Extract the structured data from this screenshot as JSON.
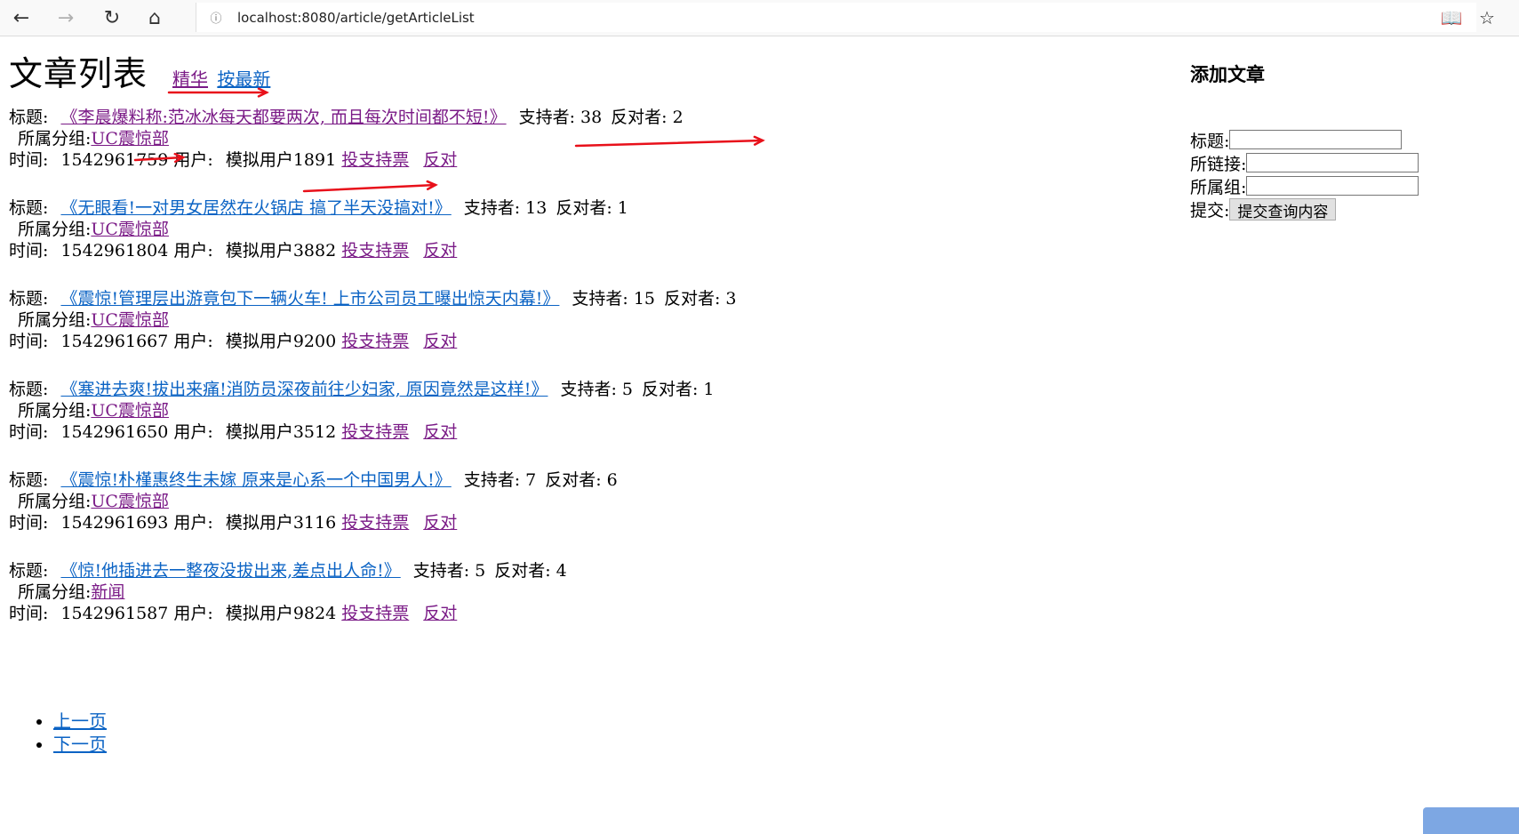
{
  "browser": {
    "url": "localhost:8080/article/getArticleList",
    "icons": [
      "back-icon",
      "forward-icon",
      "reload-icon",
      "home-icon",
      "info-icon",
      "reading-view-icon",
      "star-icon"
    ]
  },
  "page": {
    "title": "文章列表",
    "links": [
      "精华",
      "按最新"
    ]
  },
  "labels": {
    "title_prefix": "标题:",
    "support": "支持者:",
    "oppose": "反对者:",
    "group": "所属分组:",
    "time": "时间:",
    "user": "用户:",
    "vote_support": "投支持票",
    "vote_oppose": "反对"
  },
  "articles": [
    {
      "title": "《李晨爆料称:范冰冰每天都要两次, 而且每次时间都不短!》",
      "support": "38",
      "oppose": "2",
      "group": "UC震惊部",
      "time": "1542961759",
      "user": "模拟用户1891"
    },
    {
      "title": "《无眼看!一对男女居然在火锅店 搞了半天没搞对!》",
      "support": "13",
      "oppose": "1",
      "group": "UC震惊部",
      "time": "1542961804",
      "user": "模拟用户3882"
    },
    {
      "title": "《震惊!管理层出游竟包下一辆火车! 上市公司员工曝出惊天内幕!》",
      "support": "15",
      "oppose": "3",
      "group": "UC震惊部",
      "time": "1542961667",
      "user": "模拟用户9200"
    },
    {
      "title": "《塞进去爽!拔出来痛!消防员深夜前往少妇家, 原因竟然是这样!》",
      "support": "5",
      "oppose": "1",
      "group": "UC震惊部",
      "time": "1542961650",
      "user": "模拟用户3512"
    },
    {
      "title": "《震惊!朴槿惠终生未嫁 原来是心系一个中国男人!》",
      "support": "7",
      "oppose": "6",
      "group": "UC震惊部",
      "time": "1542961693",
      "user": "模拟用户3116"
    },
    {
      "title": "《惊!他插进去一整夜没拔出来,差点出人命!》",
      "support": "5",
      "oppose": "4",
      "group": "新闻",
      "time": "1542961587",
      "user": "模拟用户9824"
    }
  ],
  "add_form": {
    "heading": "添加文章",
    "title_label": "标题:",
    "link_label": "所链接:",
    "group_label": "所属组:",
    "submit_label": "提交:",
    "submit_button": "提交查询内容"
  },
  "pager": {
    "prev": "上一页",
    "next": "下一页"
  },
  "annotation_color": "#e8101a"
}
